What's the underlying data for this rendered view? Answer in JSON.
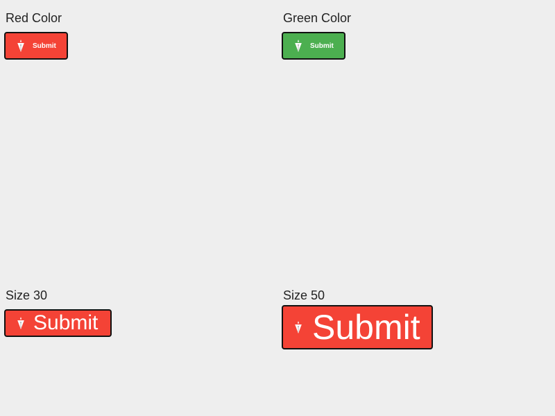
{
  "demos": [
    {
      "label": "Red Color",
      "button": {
        "text": "Submit",
        "color": "#f44336",
        "icon": "pen-nib-icon"
      }
    },
    {
      "label": "Green Color",
      "button": {
        "text": "Submit",
        "color": "#4caf50",
        "icon": "pen-nib-icon"
      }
    },
    {
      "label": "Size 30",
      "button": {
        "text": "Submit",
        "color": "#f44336",
        "icon": "pen-nib-icon"
      }
    },
    {
      "label": "Size 50",
      "button": {
        "text": "Submit",
        "color": "#f44336",
        "icon": "pen-nib-icon"
      }
    }
  ]
}
